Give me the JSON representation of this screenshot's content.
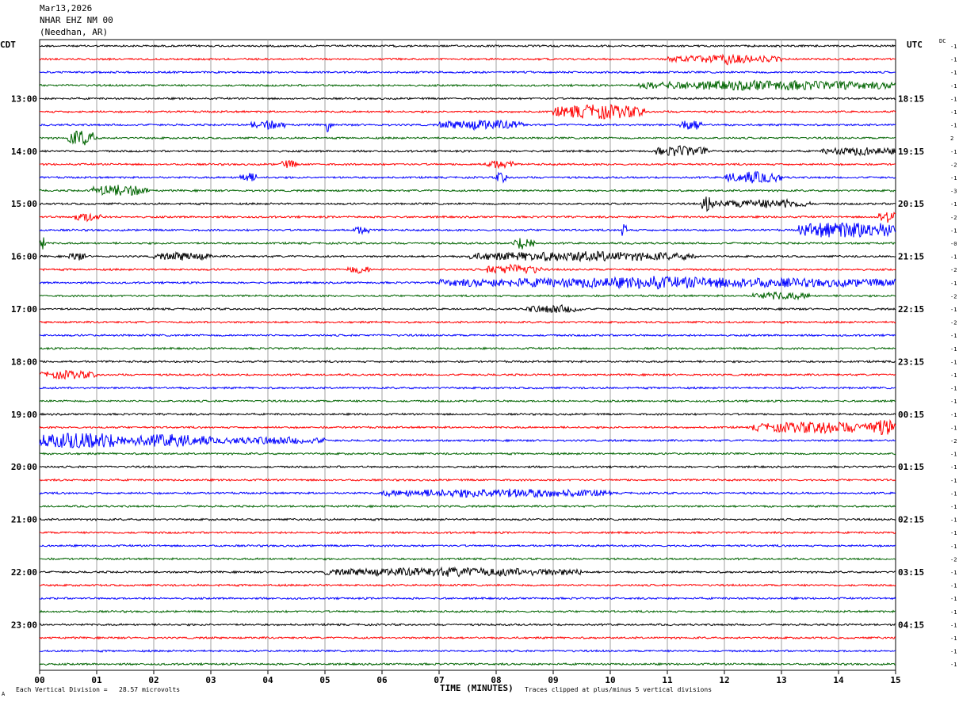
{
  "header": {
    "date": "Mar13,2026",
    "station": "NHAR EHZ NM 00",
    "location": "(Needhan, AR)"
  },
  "tz_left": "CDT",
  "tz_right": "UTC",
  "dc_label": "DC",
  "footer": {
    "vertical_division": "Each Vertical Division =   28.57 microvolts",
    "clip_note": "Traces clipped at plus/minus 5 vertical divisions",
    "corner_mark": "A"
  },
  "colors": {
    "trace_cycle": [
      "#000000",
      "#ff0000",
      "#0000ff",
      "#006400"
    ],
    "grid": "#a0a0a0",
    "background": "#ffffff"
  },
  "chart_data": {
    "type": "line",
    "title": "",
    "xlabel": "TIME (MINUTES)",
    "ylabel": "",
    "xlim": [
      0,
      15
    ],
    "x_ticks": [
      "00",
      "01",
      "02",
      "03",
      "04",
      "05",
      "06",
      "07",
      "08",
      "09",
      "10",
      "11",
      "12",
      "13",
      "14",
      "15"
    ],
    "trace_count": 48,
    "traces_per_hour": 4,
    "left_hour_labels": [
      "13:00",
      "14:00",
      "15:00",
      "16:00",
      "17:00",
      "18:00",
      "19:00",
      "20:00",
      "21:00",
      "22:00",
      "23:00"
    ],
    "right_hour_labels": [
      "18:15",
      "19:15",
      "20:15",
      "21:15",
      "22:15",
      "23:15",
      "00:15",
      "01:15",
      "02:15",
      "03:15",
      "04:15"
    ],
    "dc_offsets": [
      "-1",
      "-1",
      "-1",
      "-1",
      "-1",
      "-1",
      "-1",
      "2",
      "-1",
      "-2",
      "-1",
      "-3",
      "-1",
      "-2",
      "-1",
      "-0",
      "-1",
      "-2",
      "-1",
      "-2",
      "-1",
      "-2",
      "-1",
      "-1",
      "-1",
      "-1",
      "-1",
      "-1",
      "-1",
      "-1",
      "-2",
      "-1",
      "-1",
      "-1",
      "-1",
      "-1",
      "-1",
      "-1",
      "-1",
      "-2",
      "-1",
      "-1",
      "-1",
      "-1",
      "-1",
      "-1",
      "-1",
      "-1"
    ],
    "activity": [
      {
        "trace": 0,
        "bursts": []
      },
      {
        "trace": 1,
        "bursts": [
          [
            11.0,
            13.0,
            2.0
          ],
          [
            12.0,
            12.1,
            3.0
          ]
        ]
      },
      {
        "trace": 2,
        "bursts": []
      },
      {
        "trace": 3,
        "bursts": [
          [
            10.5,
            15.0,
            2.5
          ]
        ]
      },
      {
        "trace": 5,
        "bursts": [
          [
            9.0,
            10.6,
            4.0
          ]
        ]
      },
      {
        "trace": 6,
        "bursts": [
          [
            3.7,
            4.3,
            2.2
          ],
          [
            5.0,
            5.1,
            4.0
          ],
          [
            7.0,
            8.5,
            2.5
          ],
          [
            11.2,
            11.6,
            3.0
          ]
        ]
      },
      {
        "trace": 7,
        "bursts": [
          [
            0.5,
            1.0,
            4.5
          ]
        ]
      },
      {
        "trace": 8,
        "bursts": [
          [
            10.8,
            11.7,
            2.8
          ],
          [
            13.7,
            15.0,
            2.0
          ]
        ]
      },
      {
        "trace": 9,
        "bursts": [
          [
            4.2,
            4.5,
            2.0
          ],
          [
            7.8,
            8.3,
            2.0
          ]
        ]
      },
      {
        "trace": 10,
        "bursts": [
          [
            3.5,
            3.8,
            2.5
          ],
          [
            8.0,
            8.2,
            3.0
          ],
          [
            12.0,
            13.0,
            3.0
          ]
        ]
      },
      {
        "trace": 11,
        "bursts": [
          [
            0.9,
            1.9,
            3.0
          ]
        ]
      },
      {
        "trace": 12,
        "bursts": [
          [
            11.6,
            11.8,
            5.0
          ],
          [
            11.8,
            13.5,
            2.0
          ],
          [
            13.0,
            13.1,
            4.0
          ]
        ]
      },
      {
        "trace": 13,
        "bursts": [
          [
            0.6,
            1.1,
            2.2
          ],
          [
            14.7,
            15.0,
            3.5
          ]
        ]
      },
      {
        "trace": 14,
        "bursts": [
          [
            5.5,
            5.8,
            2.0
          ],
          [
            10.2,
            10.3,
            5.0
          ],
          [
            13.3,
            15.0,
            5.0
          ]
        ]
      },
      {
        "trace": 15,
        "bursts": [
          [
            0.0,
            0.1,
            4.0
          ],
          [
            8.3,
            8.7,
            3.5
          ]
        ]
      },
      {
        "trace": 16,
        "bursts": [
          [
            0.5,
            0.8,
            2.2
          ],
          [
            2.0,
            3.0,
            2.0
          ],
          [
            7.5,
            11.5,
            2.5
          ]
        ]
      },
      {
        "trace": 17,
        "bursts": [
          [
            5.4,
            5.8,
            2.0
          ],
          [
            7.8,
            8.8,
            2.5
          ]
        ]
      },
      {
        "trace": 18,
        "bursts": [
          [
            7.0,
            15.0,
            2.8
          ],
          [
            10.0,
            11.5,
            3.6
          ]
        ]
      },
      {
        "trace": 19,
        "bursts": [
          [
            12.5,
            13.5,
            2.0
          ]
        ]
      },
      {
        "trace": 20,
        "bursts": [
          [
            8.5,
            9.5,
            2.0
          ]
        ]
      },
      {
        "trace": 24,
        "bursts": []
      },
      {
        "trace": 25,
        "bursts": [
          [
            0.0,
            1.0,
            2.0
          ]
        ]
      },
      {
        "trace": 29,
        "bursts": [
          [
            12.5,
            15.0,
            3.0
          ],
          [
            14.5,
            15.0,
            5.0
          ]
        ]
      },
      {
        "trace": 30,
        "bursts": [
          [
            0.0,
            1.5,
            5.0
          ],
          [
            1.5,
            3.0,
            3.5
          ],
          [
            3.0,
            5.0,
            1.8
          ]
        ]
      },
      {
        "trace": 34,
        "bursts": [
          [
            6.0,
            10.0,
            2.2
          ]
        ]
      },
      {
        "trace": 40,
        "bursts": [
          [
            5.0,
            9.5,
            2.2
          ]
        ]
      }
    ]
  }
}
